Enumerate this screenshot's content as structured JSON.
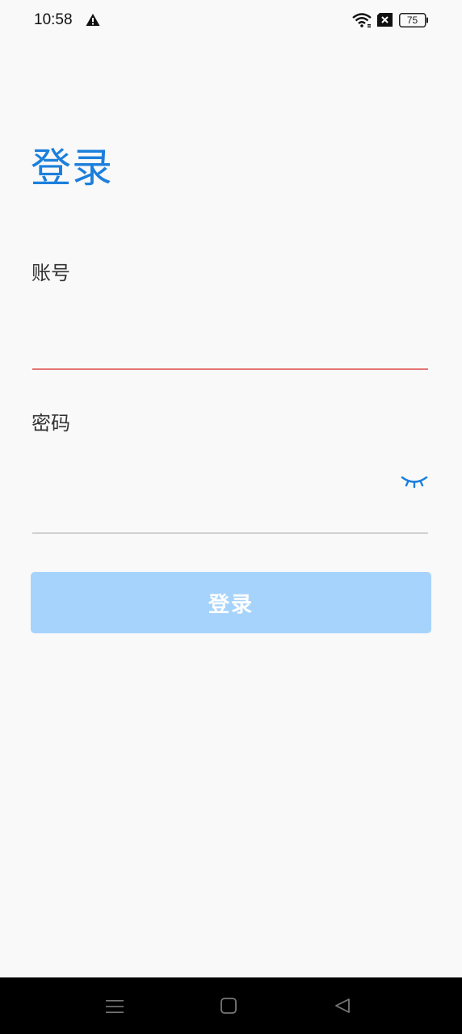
{
  "status_bar": {
    "time": "10:58",
    "battery": "75",
    "icons": [
      "warning-icon",
      "wifi-icon",
      "sim-off-icon",
      "battery-icon"
    ]
  },
  "login": {
    "title": "登录",
    "account_label": "账号",
    "account_value": "",
    "password_label": "密码",
    "password_value": "",
    "submit_label": "登录"
  },
  "colors": {
    "accent": "#1c7fdc",
    "button_disabled": "#a6d3fc",
    "error_underline": "#e57373",
    "background": "#f9f9f9"
  },
  "nav_bar": {
    "icons": [
      "menu-icon",
      "home-icon",
      "back-icon"
    ]
  }
}
